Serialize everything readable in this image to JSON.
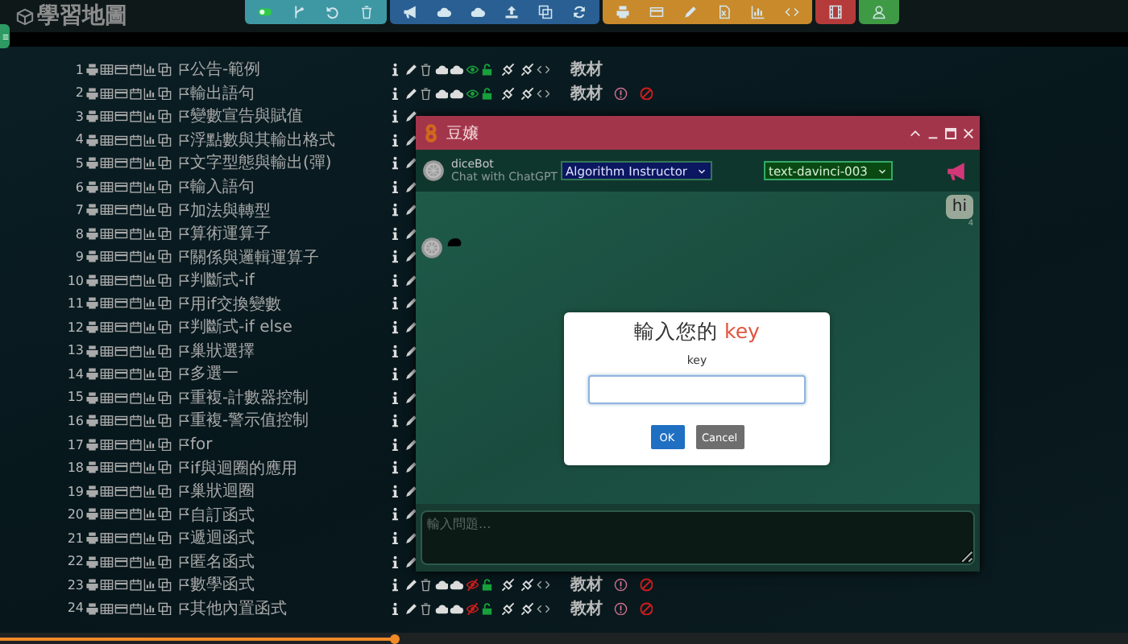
{
  "app": {
    "title": "學習地圖"
  },
  "toolbar_groups": [
    {
      "color": "#3d98a3",
      "buttons": [
        {
          "kind": "toggle",
          "on": true
        },
        {
          "kind": "branch"
        },
        {
          "kind": "undo"
        },
        {
          "kind": "trash"
        }
      ]
    },
    {
      "color": "#2a5f93",
      "buttons": [
        {
          "kind": "megaphone"
        },
        {
          "kind": "cloud-upload"
        },
        {
          "kind": "cloud-download"
        },
        {
          "kind": "upload"
        },
        {
          "kind": "copy"
        },
        {
          "kind": "refresh"
        }
      ]
    },
    {
      "color": "#c98a2c",
      "buttons": [
        {
          "kind": "printer"
        },
        {
          "kind": "card"
        },
        {
          "kind": "pencil"
        },
        {
          "kind": "excel"
        },
        {
          "kind": "chart"
        },
        {
          "kind": "code"
        }
      ]
    },
    {
      "color": "#b53a3a",
      "buttons": [
        {
          "kind": "film"
        }
      ]
    },
    {
      "color": "#3f9a45",
      "buttons": [
        {
          "kind": "user"
        }
      ]
    }
  ],
  "lessons": [
    {
      "number": "1",
      "title": "公告-範例",
      "material": "教材",
      "hidden": false,
      "alert": false,
      "blocked": false
    },
    {
      "number": "2",
      "title": "輸出語句",
      "material": "教材",
      "hidden": false,
      "alert": true,
      "blocked": true
    },
    {
      "number": "3",
      "title": "變數宣告與賦值"
    },
    {
      "number": "4",
      "title": "浮點數與其輸出格式"
    },
    {
      "number": "5",
      "title": "文字型態與輸出(彈)"
    },
    {
      "number": "6",
      "title": "輸入語句"
    },
    {
      "number": "7",
      "title": "加法與轉型"
    },
    {
      "number": "8",
      "title": "算術運算子"
    },
    {
      "number": "9",
      "title": "關係與邏輯運算子"
    },
    {
      "number": "10",
      "title": "判斷式-if"
    },
    {
      "number": "11",
      "title": "用if交換變數"
    },
    {
      "number": "12",
      "title": "判斷式-if else"
    },
    {
      "number": "13",
      "title": "巢狀選擇"
    },
    {
      "number": "14",
      "title": "多選一"
    },
    {
      "number": "15",
      "title": "重複-計數器控制"
    },
    {
      "number": "16",
      "title": "重複-警示值控制"
    },
    {
      "number": "17",
      "title": "for"
    },
    {
      "number": "18",
      "title": "if與迴圈的應用"
    },
    {
      "number": "19",
      "title": "巢狀迴圈"
    },
    {
      "number": "20",
      "title": "自訂函式"
    },
    {
      "number": "21",
      "title": "遞迴函式"
    },
    {
      "number": "22",
      "title": "匿名函式"
    },
    {
      "number": "23",
      "title": "數學函式",
      "material": "教材",
      "hidden": true,
      "alert": true,
      "blocked": true
    },
    {
      "number": "24",
      "title": "其他內置函式",
      "material": "教材",
      "hidden": true,
      "alert": true,
      "blocked": true
    }
  ],
  "chat": {
    "title": "豆嬢",
    "bot_name": "diceBot",
    "subtitle": "Chat with ChatGPT",
    "role": "Algorithm Instructor",
    "model": "text-davinci-003",
    "messages": [
      {
        "kind": "user",
        "text": "hi",
        "meta": "4"
      },
      {
        "kind": "bot-typing"
      }
    ],
    "input_placeholder": "輸入問題..."
  },
  "dialog": {
    "title": "輸入您的",
    "title_highlight": "key",
    "label": "key",
    "buttons": [
      {
        "label": "OK",
        "kind": "primary"
      },
      {
        "label": "Cancel",
        "kind": "secondary"
      }
    ]
  },
  "scrubber": {
    "level": 0.35
  }
}
